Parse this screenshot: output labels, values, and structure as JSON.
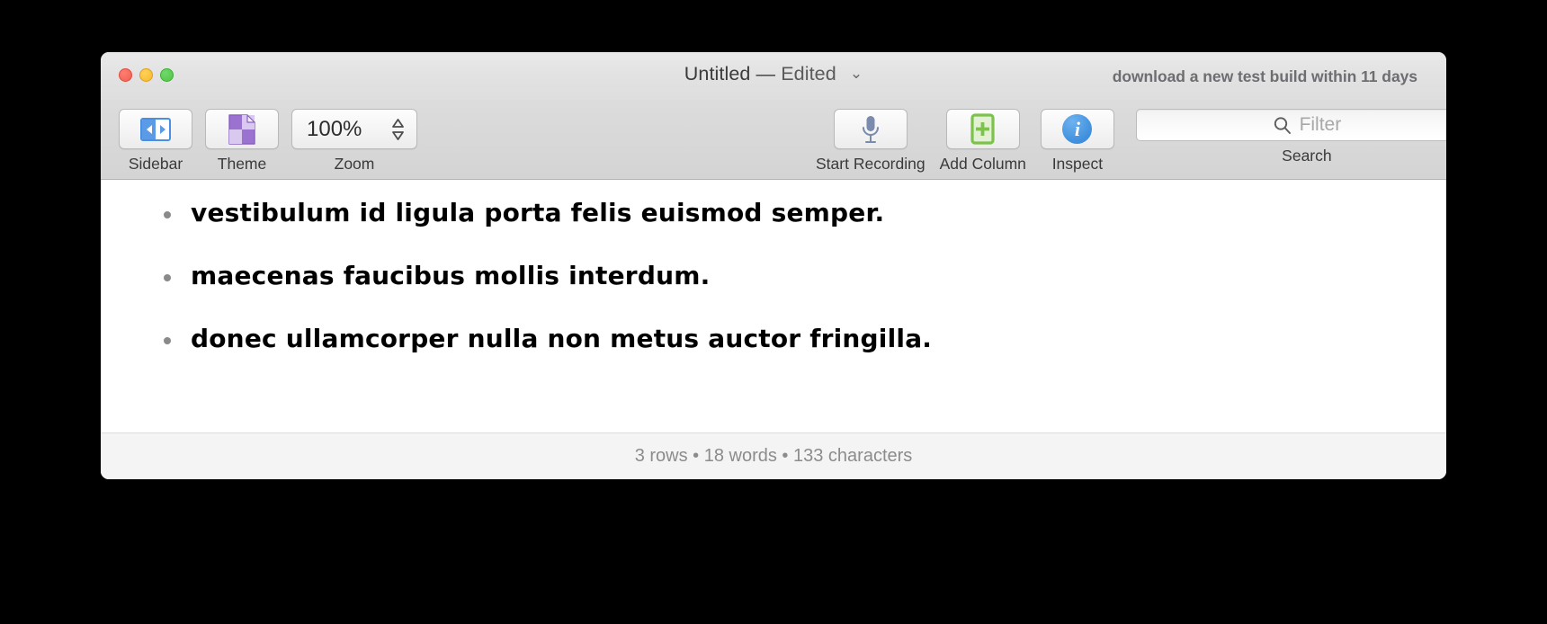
{
  "window": {
    "title_name": "Untitled",
    "title_separator": "—",
    "title_state": "Edited",
    "title_chevron": "⌄",
    "banner": "download a new test build within 11 days"
  },
  "traffic_lights": {
    "close": "close-window",
    "minimize": "minimize-window",
    "maximize": "maximize-window"
  },
  "toolbar": {
    "sidebar": {
      "label": "Sidebar",
      "icon": "sidebar-icon"
    },
    "theme": {
      "label": "Theme",
      "icon": "theme-document-icon"
    },
    "zoom": {
      "label": "Zoom",
      "value": "100%",
      "up": "▲",
      "down": "▼"
    },
    "record": {
      "label": "Start Recording",
      "icon": "microphone-icon"
    },
    "add_column": {
      "label": "Add Column",
      "icon": "add-column-icon"
    },
    "inspect": {
      "label": "Inspect",
      "icon": "info-icon",
      "glyph": "i"
    },
    "search": {
      "label": "Search",
      "placeholder": "Filter",
      "value": "",
      "icon": "search-icon"
    }
  },
  "document": {
    "rows": [
      "vestibulum id ligula porta felis euismod semper.",
      "maecenas faucibus mollis interdum.",
      "donec ullamcorper nulla non metus auctor fringilla."
    ]
  },
  "status": {
    "text": "3 rows • 18 words • 133 characters",
    "rows": 3,
    "words": 18,
    "characters": 133
  },
  "colors": {
    "accent_blue": "#4a90e2",
    "theme_purple": "#9b72d0",
    "add_green": "#7dc24b",
    "info_blue": "#3f8fdd",
    "close_red": "#ef6054",
    "min_yellow": "#f7b82e",
    "max_green": "#53c447"
  }
}
